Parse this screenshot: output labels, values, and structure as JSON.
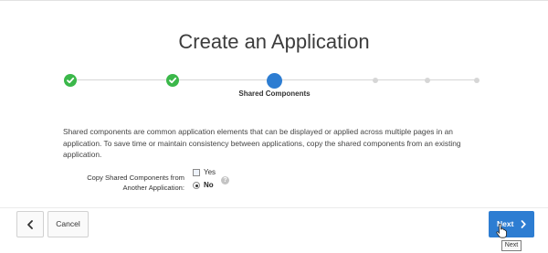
{
  "page": {
    "title": "Create an Application"
  },
  "wizard": {
    "current_step_label": "Shared Components",
    "steps": [
      {
        "state": "done",
        "icon": "check-icon"
      },
      {
        "state": "done",
        "icon": "check-icon"
      },
      {
        "state": "current"
      },
      {
        "state": "pending"
      },
      {
        "state": "pending"
      },
      {
        "state": "pending"
      }
    ]
  },
  "content": {
    "description": "Shared components are common application elements that can be displayed or applied across multiple pages in an application. To save time or maintain consistency between applications, copy the shared components from an existing application.",
    "field_label": "Copy Shared Components from Another Application:",
    "option_yes": "Yes",
    "option_no": "No",
    "option_yes_checked": false,
    "option_no_selected": true,
    "help_glyph": "?"
  },
  "footer": {
    "cancel_label": "Cancel",
    "next_label": "Next",
    "next_tooltip": "Next",
    "back_icon": "chevron-left-icon",
    "next_icon": "chevron-right-icon"
  },
  "colors": {
    "step_done": "#3bb84a",
    "step_current": "#2d7dd2",
    "primary_button": "#2d7dd2"
  }
}
